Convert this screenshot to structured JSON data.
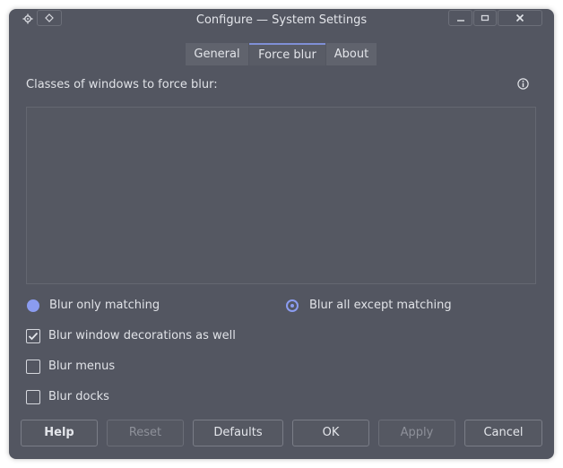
{
  "window": {
    "title": "Configure — System Settings"
  },
  "titlebar_icons": {
    "menu": "gear-icon",
    "keep_above": "diamond-icon",
    "minimize": "minimize-icon",
    "maximize": "maximize-icon",
    "close": "close-icon"
  },
  "tabs": [
    {
      "label": "General",
      "active": false
    },
    {
      "label": "Force blur",
      "active": true
    },
    {
      "label": "About",
      "active": false
    }
  ],
  "classes": {
    "label": "Classes of windows to force blur:",
    "info_icon": "info-icon",
    "value": ""
  },
  "mode": {
    "option_only": {
      "label": "Blur only matching",
      "selected": false
    },
    "option_except": {
      "label": "Blur all except matching",
      "selected": true
    }
  },
  "checkboxes": [
    {
      "label": "Blur window decorations as well",
      "checked": true
    },
    {
      "label": "Blur menus",
      "checked": false
    },
    {
      "label": "Blur docks",
      "checked": false
    }
  ],
  "buttons": {
    "help": {
      "label": "Help",
      "enabled": true
    },
    "reset": {
      "label": "Reset",
      "enabled": false
    },
    "defaults": {
      "label": "Defaults",
      "enabled": true
    },
    "ok": {
      "label": "OK",
      "enabled": true
    },
    "apply": {
      "label": "Apply",
      "enabled": false
    },
    "cancel": {
      "label": "Cancel",
      "enabled": true
    }
  },
  "colors": {
    "window_bg": "#535661",
    "accent": "#8b9cf0",
    "tab_active_border": "#7f8fd6"
  }
}
